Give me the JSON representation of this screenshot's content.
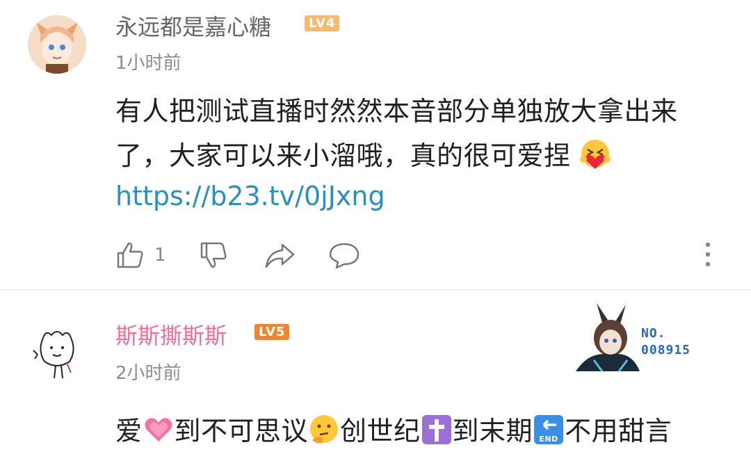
{
  "comments": [
    {
      "username": "永远都是嘉心糖",
      "level": "LV4",
      "time": "1小时前",
      "text_line1": "有人把测试直播时然然本音部分单独放大拿出来",
      "text_line2": "了，大家可以来小溜哦，真的很可爱捏",
      "link": "https://b23.tv/0jJxng",
      "like_count": "1"
    },
    {
      "username": "斯斯撕斯斯",
      "level": "LV5",
      "time": "2小时前",
      "badge_no_label": "NO.",
      "badge_no_value": "008915",
      "text_seg1": "爱",
      "text_seg2": "到不可思议",
      "text_seg3": "创世纪",
      "text_seg4": "到末期",
      "text_seg5": "不用甜言",
      "end_label": "END"
    }
  ],
  "colors": {
    "username_highlight": "#f06d98",
    "link": "#2a8fbd",
    "lv4": "#f7b96e",
    "lv5": "#f3842e"
  }
}
